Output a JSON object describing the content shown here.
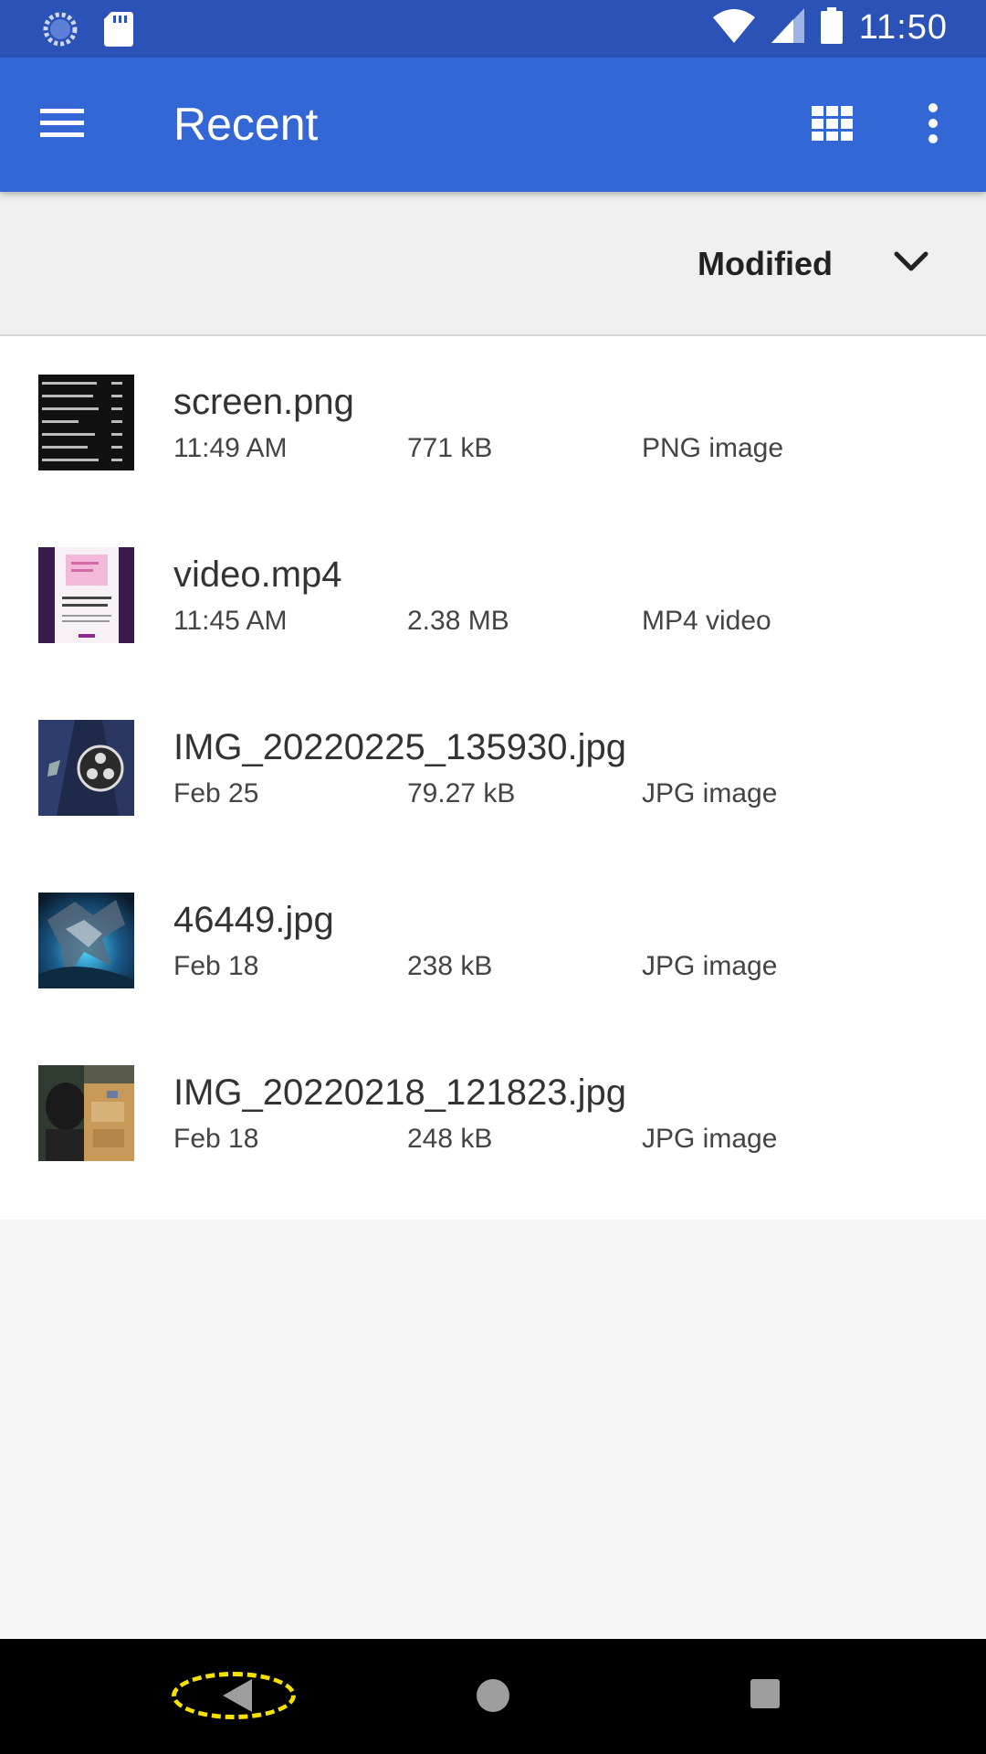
{
  "status_bar": {
    "time": "11:50",
    "icons": [
      "sync-icon",
      "sd-card-icon",
      "wifi-icon",
      "cell-signal-icon",
      "battery-icon"
    ]
  },
  "app_bar": {
    "title": "Recent",
    "background": "#3367d6",
    "status_background": "#2b52b7"
  },
  "sort_bar": {
    "label": "Modified"
  },
  "files": [
    {
      "name": "screen.png",
      "date": "11:49 AM",
      "size": "771 kB",
      "type": "PNG image",
      "thumb": "screenshot-thumb"
    },
    {
      "name": "video.mp4",
      "date": "11:45 AM",
      "size": "2.38 MB",
      "type": "MP4 video",
      "thumb": "video-thumb"
    },
    {
      "name": "IMG_20220225_135930.jpg",
      "date": "Feb 25",
      "size": "79.27 kB",
      "type": "JPG image",
      "thumb": "obs-logo-thumb"
    },
    {
      "name": "46449.jpg",
      "date": "Feb 18",
      "size": "238 kB",
      "type": "JPG image",
      "thumb": "dragon-art-thumb"
    },
    {
      "name": "IMG_20220218_121823.jpg",
      "date": "Feb 18",
      "size": "248 kB",
      "type": "JPG image",
      "thumb": "photo-thumb"
    }
  ],
  "nav_bar": {
    "icons": [
      "back-icon",
      "home-icon",
      "recents-icon"
    ]
  }
}
